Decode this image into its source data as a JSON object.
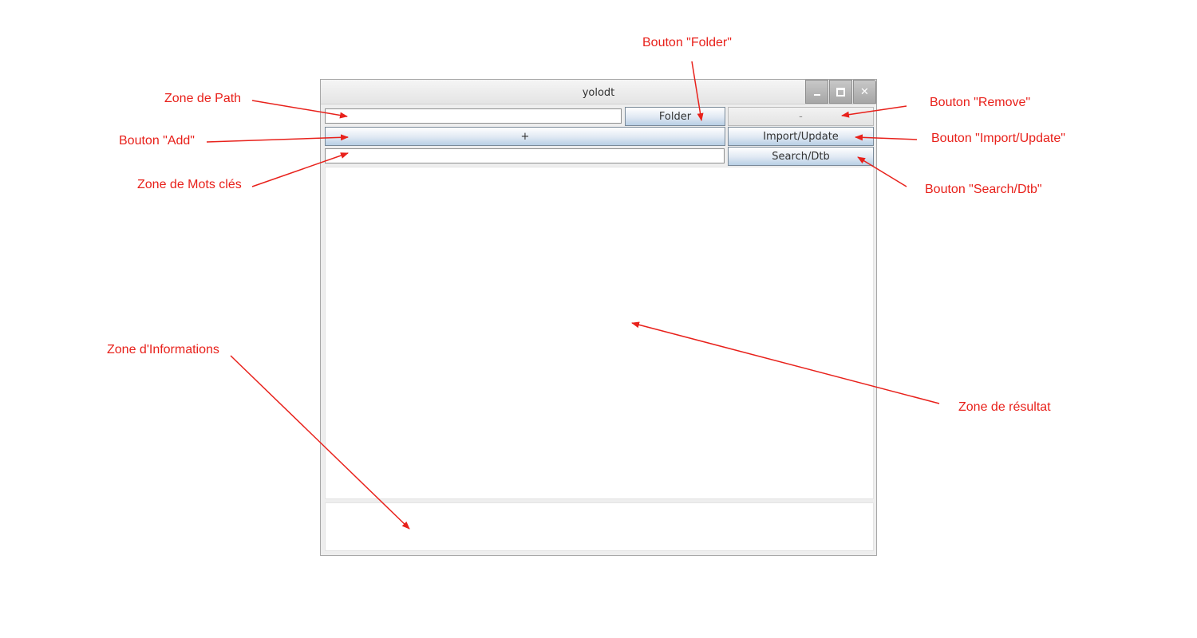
{
  "window": {
    "title": "yolodt",
    "controls": [
      "minimize-icon",
      "maximize-icon",
      "close-icon"
    ]
  },
  "toolbar": {
    "path_value": "",
    "folder_label": "Folder",
    "remove_label": "-",
    "add_label": "+",
    "import_label": "Import/Update",
    "keywords_value": "",
    "search_label": "Search/Dtb"
  },
  "areas": {
    "result_text": "",
    "info_text": ""
  },
  "annotations": {
    "color": "#e8211b",
    "folder": "Bouton \"Folder\"",
    "path": "Zone de Path",
    "remove": "Bouton \"Remove\"",
    "add": "Bouton \"Add\"",
    "import": "Bouton \"Import/Update\"",
    "keywords": "Zone de Mots clés",
    "search": "Bouton \"Search/Dtb\"",
    "informations": "Zone d'Informations",
    "result": "Zone de résultat"
  }
}
